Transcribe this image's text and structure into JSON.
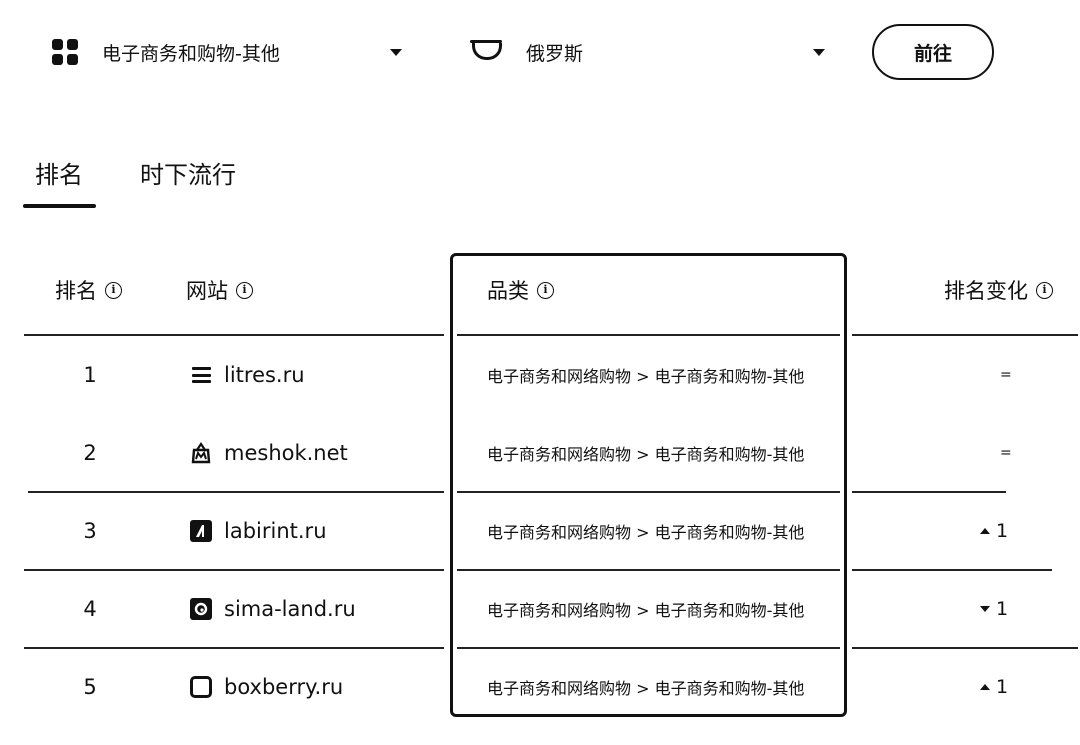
{
  "filters": {
    "category": {
      "label": "电子商务和购物-其他",
      "icon": "grid-icon"
    },
    "country": {
      "label": "俄罗斯",
      "icon": "russia-flag-icon"
    },
    "go_label": "前往"
  },
  "tabs": [
    {
      "label": "排名",
      "active": true
    },
    {
      "label": "时下流行",
      "active": false
    }
  ],
  "table": {
    "headers": {
      "rank": "排名",
      "site": "网站",
      "category": "品类",
      "change": "排名变化"
    },
    "rows": [
      {
        "rank": "1",
        "site": "litres.ru",
        "icon": "litres-icon",
        "category": "电子商务和网络购物 > 电子商务和购物-其他",
        "change": "=",
        "direction": "same"
      },
      {
        "rank": "2",
        "site": "meshok.net",
        "icon": "meshok-icon",
        "category": "电子商务和网络购物 > 电子商务和购物-其他",
        "change": "=",
        "direction": "same"
      },
      {
        "rank": "3",
        "site": "labirint.ru",
        "icon": "labirint-icon",
        "category": "电子商务和网络购物 > 电子商务和购物-其他",
        "change": "1",
        "direction": "up"
      },
      {
        "rank": "4",
        "site": "sima-land.ru",
        "icon": "sima-land-icon",
        "category": "电子商务和网络购物 > 电子商务和购物-其他",
        "change": "1",
        "direction": "down"
      },
      {
        "rank": "5",
        "site": "boxberry.ru",
        "icon": "boxberry-icon",
        "category": "电子商务和网络购物 > 电子商务和购物-其他",
        "change": "1",
        "direction": "up"
      }
    ]
  }
}
